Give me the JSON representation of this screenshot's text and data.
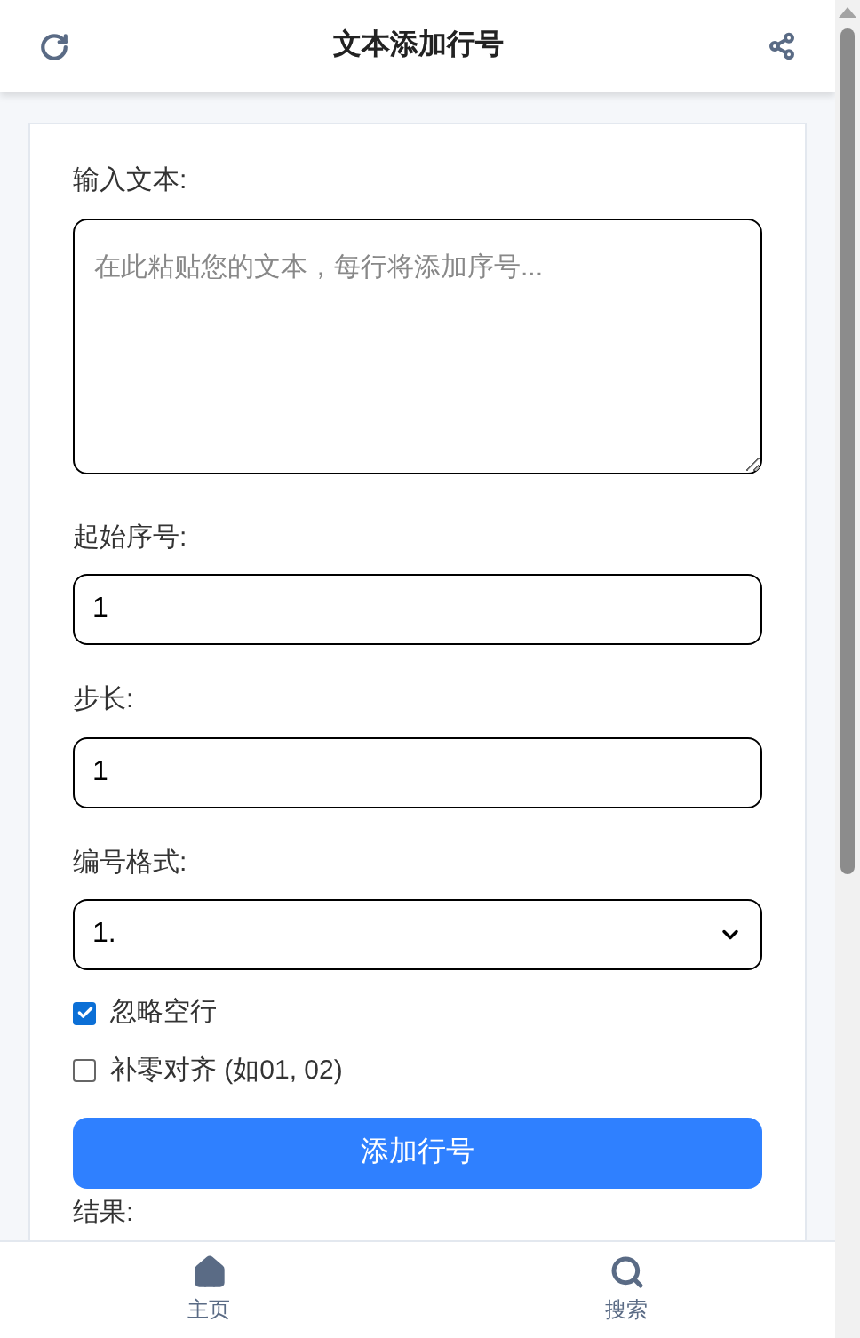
{
  "header": {
    "title": "文本添加行号"
  },
  "form": {
    "text_label": "输入文本:",
    "text_placeholder": "在此粘贴您的文本，每行将添加序号...",
    "start_label": "起始序号:",
    "start_value": "1",
    "step_label": "步长:",
    "step_value": "1",
    "format_label": "编号格式:",
    "format_value": "1.",
    "options": [
      {
        "label": "忽略空行",
        "checked": true
      },
      {
        "label": "补零对齐 (如01, 02)",
        "checked": false
      }
    ],
    "submit": "添加行号",
    "result_label": "结果:"
  },
  "bottom_nav": [
    {
      "label": "主页",
      "kind": "home"
    },
    {
      "label": "搜索",
      "kind": "search"
    }
  ]
}
